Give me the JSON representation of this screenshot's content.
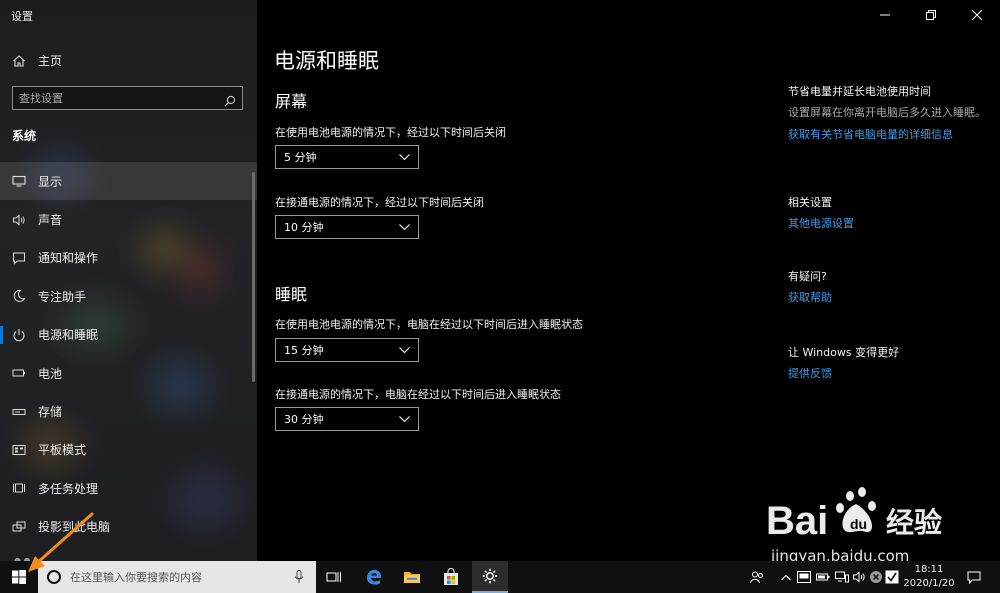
{
  "window": {
    "title": "设置"
  },
  "sidebar": {
    "home_label": "主页",
    "search_placeholder": "查找设置",
    "section_label": "系统",
    "items": [
      {
        "label": "显示",
        "icon": "monitor-icon"
      },
      {
        "label": "声音",
        "icon": "speaker-icon"
      },
      {
        "label": "通知和操作",
        "icon": "notification-icon"
      },
      {
        "label": "专注助手",
        "icon": "moon-icon"
      },
      {
        "label": "电源和睡眠",
        "icon": "power-icon",
        "selected": true
      },
      {
        "label": "电池",
        "icon": "battery-icon"
      },
      {
        "label": "存储",
        "icon": "storage-icon"
      },
      {
        "label": "平板模式",
        "icon": "tablet-icon"
      },
      {
        "label": "多任务处理",
        "icon": "multitask-icon"
      },
      {
        "label": "投影到此电脑",
        "icon": "project-icon"
      }
    ]
  },
  "main": {
    "title": "电源和睡眠",
    "screen": {
      "heading": "屏幕",
      "battery_label": "在使用电池电源的情况下，经过以下时间后关闭",
      "battery_value": "5 分钟",
      "plugged_label": "在接通电源的情况下，经过以下时间后关闭",
      "plugged_value": "10 分钟"
    },
    "sleep": {
      "heading": "睡眠",
      "battery_label": "在使用电池电源的情况下，电脑在经过以下时间后进入睡眠状态",
      "battery_value": "15 分钟",
      "plugged_label": "在接通电源的情况下，电脑在经过以下时间后进入睡眠状态",
      "plugged_value": "30 分钟"
    }
  },
  "aside": {
    "save_power": {
      "heading": "节省电量并延长电池使用时间",
      "text": "设置屏幕在你离开电脑后多久进入睡眠。",
      "link": "获取有关节省电脑电量的详细信息"
    },
    "related": {
      "heading": "相关设置",
      "link": "其他电源设置"
    },
    "questions": {
      "heading": "有疑问?",
      "link": "获取帮助"
    },
    "feedback": {
      "heading": "让 Windows 变得更好",
      "link": "提供反馈"
    }
  },
  "taskbar": {
    "search_placeholder": "在这里输入你要搜索的内容",
    "time": "18:11",
    "date": "2020/1/20"
  },
  "watermark": {
    "url": "jingyan.baidu.com"
  },
  "colors": {
    "accent": "#0a78d7",
    "link": "#3a9be8",
    "arrow": "#f28a1e"
  }
}
